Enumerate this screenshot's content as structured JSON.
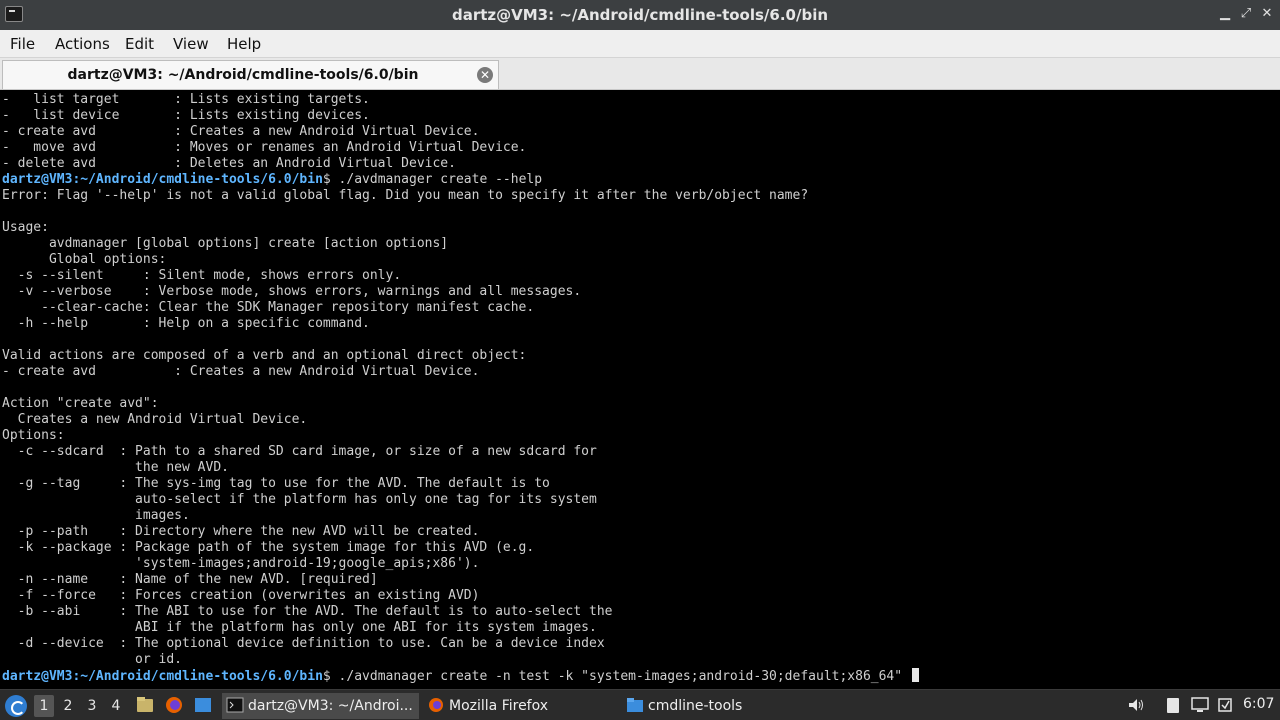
{
  "window": {
    "title": "dartz@VM3: ~/Android/cmdline-tools/6.0/bin",
    "controls": {
      "minimize": "▁",
      "maximize": "⤢",
      "close": "✕"
    }
  },
  "menubar": {
    "items": [
      "File",
      "Actions",
      "Edit",
      "View",
      "Help"
    ]
  },
  "tab": {
    "label": "dartz@VM3: ~/Android/cmdline-tools/6.0/bin",
    "close_icon": "✕"
  },
  "terminal": {
    "prompt": "dartz@VM3:~/Android/cmdline-tools/6.0/bin",
    "lines": [
      {
        "text": "-   list target       : Lists existing targets."
      },
      {
        "text": "-   list device       : Lists existing devices."
      },
      {
        "text": "- create avd          : Creates a new Android Virtual Device."
      },
      {
        "text": "-   move avd          : Moves or renames an Android Virtual Device."
      },
      {
        "text": "- delete avd          : Deletes an Android Virtual Device."
      },
      {
        "prompt": true,
        "text": "$ ./avdmanager create --help"
      },
      {
        "text": "Error: Flag '--help' is not a valid global flag. Did you mean to specify it after the verb/object name?"
      },
      {
        "text": ""
      },
      {
        "text": "Usage:"
      },
      {
        "text": "      avdmanager [global options] create [action options]"
      },
      {
        "text": "      Global options:"
      },
      {
        "text": "  -s --silent     : Silent mode, shows errors only."
      },
      {
        "text": "  -v --verbose    : Verbose mode, shows errors, warnings and all messages."
      },
      {
        "text": "     --clear-cache: Clear the SDK Manager repository manifest cache."
      },
      {
        "text": "  -h --help       : Help on a specific command."
      },
      {
        "text": ""
      },
      {
        "text": "Valid actions are composed of a verb and an optional direct object:"
      },
      {
        "text": "- create avd          : Creates a new Android Virtual Device."
      },
      {
        "text": ""
      },
      {
        "text": "Action \"create avd\":"
      },
      {
        "text": "  Creates a new Android Virtual Device."
      },
      {
        "text": "Options:"
      },
      {
        "text": "  -c --sdcard  : Path to a shared SD card image, or size of a new sdcard for"
      },
      {
        "text": "                 the new AVD."
      },
      {
        "text": "  -g --tag     : The sys-img tag to use for the AVD. The default is to"
      },
      {
        "text": "                 auto-select if the platform has only one tag for its system"
      },
      {
        "text": "                 images."
      },
      {
        "text": "  -p --path    : Directory where the new AVD will be created."
      },
      {
        "text": "  -k --package : Package path of the system image for this AVD (e.g."
      },
      {
        "text": "                 'system-images;android-19;google_apis;x86')."
      },
      {
        "text": "  -n --name    : Name of the new AVD. [required]"
      },
      {
        "text": "  -f --force   : Forces creation (overwrites an existing AVD)"
      },
      {
        "text": "  -b --abi     : The ABI to use for the AVD. The default is to auto-select the"
      },
      {
        "text": "                 ABI if the platform has only one ABI for its system images."
      },
      {
        "text": "  -d --device  : The optional device definition to use. Can be a device index"
      },
      {
        "text": "                 or id."
      },
      {
        "prompt": true,
        "text": "$ ./avdmanager create -n test -k \"system-images;android-30;default;x86_64\" ",
        "cursor": true
      }
    ]
  },
  "taskbar": {
    "workspaces": [
      "1",
      "2",
      "3",
      "4"
    ],
    "active_workspace": "1",
    "tasks": [
      {
        "label": "dartz@VM3: ~/Androi...",
        "icon": "terminal-icon",
        "active": true
      },
      {
        "label": "Mozilla Firefox",
        "icon": "firefox-icon",
        "active": false
      },
      {
        "label": "cmdline-tools",
        "icon": "folder-icon",
        "active": false
      }
    ],
    "clock": "6:07"
  },
  "colors": {
    "prompt": "#5fb6ff",
    "terminal_bg": "#000000",
    "terminal_fg": "#cfcfcf",
    "titlebar_bg": "#3c3f41",
    "taskbar_bg": "#2b2b2b"
  }
}
